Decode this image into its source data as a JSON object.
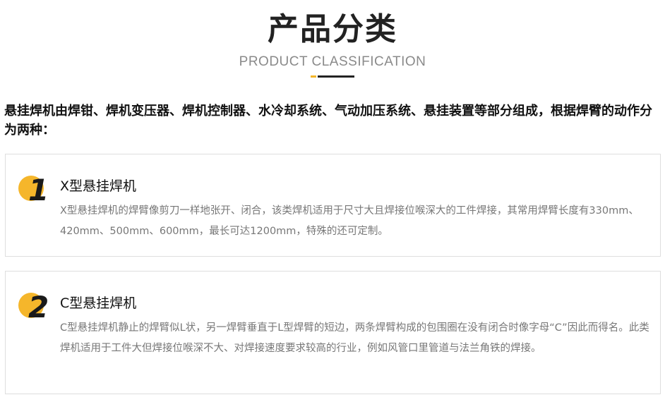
{
  "header": {
    "title": "产品分类",
    "subtitle": "PRODUCT CLASSIFICATION"
  },
  "intro": {
    "text": "悬挂焊机由焊钳、焊机变压器、焊机控制器、水冷却系统、气动加压系统、悬挂装置等部分组成，根据焊臂的动作分为两种："
  },
  "cards": [
    {
      "number": "1",
      "title": "X型悬挂焊机",
      "text": "X型悬挂焊机的焊臂像剪刀一样地张开、闭合，该类焊机适用于尺寸大且焊接位喉深大的工件焊接，其常用焊臂长度有330mm、420mm、500mm、600mm，最长可达1200mm，特殊的还可定制。"
    },
    {
      "number": "2",
      "title": "C型悬挂焊机",
      "text": "C型悬挂焊机静止的焊臂似L状，另一焊臂垂直于L型焊臂的短边，两条焊臂构成的包围圈在没有闭合时像字母“C”因此而得名。此类焊机适用于工件大但焊接位喉深不大、对焊接速度要求较高的行业，例如风管口里管道与法兰角铁的焊接。"
    }
  ],
  "colors": {
    "accent": "#f5b62b",
    "text_dark": "#111111",
    "text_muted": "#777777",
    "border": "#dedede"
  }
}
